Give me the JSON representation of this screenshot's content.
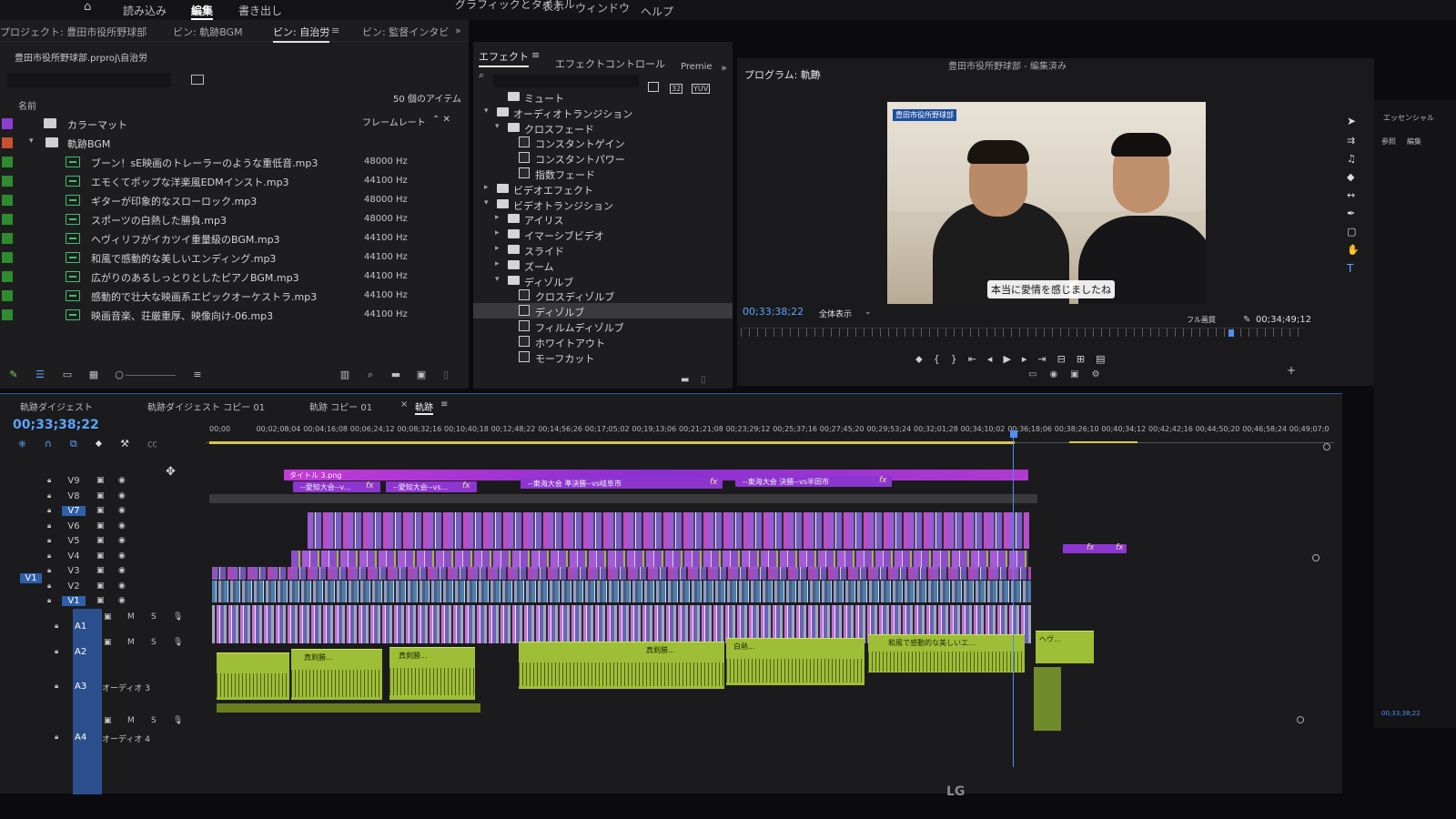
{
  "menubar": {
    "items": [
      "読み込み",
      "編集",
      "書き出し",
      "グラフィックとタイトル",
      "表示",
      "ウィンドウ",
      "ヘルプ"
    ],
    "active": "編集"
  },
  "project": {
    "title": "プロジェクト: 豊田市役所野球部",
    "bins": [
      "ビン: 軌跡BGM",
      "ビン: 自治労",
      "ビン: 監督インタビ"
    ],
    "active_bin": "ビン: 自治労",
    "path": "豊田市役所野球部.prproj\\自治労",
    "item_count": "50 個のアイテム",
    "col_name": "名前",
    "col_framerate": "フレームレート",
    "rows": [
      {
        "name": "カラーマット",
        "hz": "",
        "type": "matte"
      },
      {
        "name": "軌跡BGM",
        "hz": "",
        "type": "folder"
      },
      {
        "name": "ブーン！sE映画のトレーラーのような重低音.mp3",
        "hz": "48000 Hz",
        "type": "audio"
      },
      {
        "name": "エモくてポップな洋楽風EDMインスト.mp3",
        "hz": "44100 Hz",
        "type": "audio"
      },
      {
        "name": "ギターが印象的なスローロック.mp3",
        "hz": "48000 Hz",
        "type": "audio"
      },
      {
        "name": "スポーツの白熱した勝負.mp3",
        "hz": "48000 Hz",
        "type": "audio"
      },
      {
        "name": "ヘヴィリフがイカツイ重量級のBGM.mp3",
        "hz": "44100 Hz",
        "type": "audio"
      },
      {
        "name": "和風で感動的な美しいエンディング.mp3",
        "hz": "44100 Hz",
        "type": "audio"
      },
      {
        "name": "広がりのあるしっとりとしたピアノBGM.mp3",
        "hz": "44100 Hz",
        "type": "audio"
      },
      {
        "name": "感動的で壮大な映画系エピックオーケストラ.mp3",
        "hz": "44100 Hz",
        "type": "audio"
      },
      {
        "name": "映画音楽、荘厳重厚、映像向け-06.mp3",
        "hz": "44100 Hz",
        "type": "audio"
      }
    ]
  },
  "effects": {
    "tabs": [
      "エフェクト",
      "エフェクトコントロール",
      "Premie"
    ],
    "active_tab": "エフェクト",
    "tree": [
      {
        "label": "ミュート",
        "depth": 1,
        "kind": "folder",
        "arrow": ""
      },
      {
        "label": "オーディオトランジション",
        "depth": 0,
        "kind": "folder",
        "arrow": "▾"
      },
      {
        "label": "クロスフェード",
        "depth": 1,
        "kind": "folder",
        "arrow": "▾"
      },
      {
        "label": "コンスタントゲイン",
        "depth": 2,
        "kind": "fx",
        "arrow": ""
      },
      {
        "label": "コンスタントパワー",
        "depth": 2,
        "kind": "fx",
        "arrow": ""
      },
      {
        "label": "指数フェード",
        "depth": 2,
        "kind": "fx",
        "arrow": ""
      },
      {
        "label": "ビデオエフェクト",
        "depth": 0,
        "kind": "folder",
        "arrow": "▸"
      },
      {
        "label": "ビデオトランジション",
        "depth": 0,
        "kind": "folder",
        "arrow": "▾"
      },
      {
        "label": "アイリス",
        "depth": 1,
        "kind": "folder",
        "arrow": "▸"
      },
      {
        "label": "イマーシブビデオ",
        "depth": 1,
        "kind": "folder",
        "arrow": "▸"
      },
      {
        "label": "スライド",
        "depth": 1,
        "kind": "folder",
        "arrow": "▸"
      },
      {
        "label": "ズーム",
        "depth": 1,
        "kind": "folder",
        "arrow": "▸"
      },
      {
        "label": "ディゾルブ",
        "depth": 1,
        "kind": "folder",
        "arrow": "▾"
      },
      {
        "label": "クロスディゾルブ",
        "depth": 2,
        "kind": "fx",
        "arrow": ""
      },
      {
        "label": "ディゾルブ",
        "depth": 2,
        "kind": "fx",
        "arrow": "",
        "selected": true
      },
      {
        "label": "フィルムディゾルブ",
        "depth": 2,
        "kind": "fx",
        "arrow": ""
      },
      {
        "label": "ホワイトアウト",
        "depth": 2,
        "kind": "fx",
        "arrow": ""
      },
      {
        "label": "モーフカット",
        "depth": 2,
        "kind": "fx",
        "arrow": ""
      }
    ]
  },
  "program": {
    "title": "プログラム: 軌跡",
    "header_center": "豊田市役所野球部 - 編集済み",
    "timecode": "00;33;38;22",
    "fit": "全体表示",
    "quality": "フル画質",
    "duration": "00;34;49;12",
    "video_caption_top": "豊田市役所野球部",
    "video_subtitle": "本当に愛情を感じましたね"
  },
  "timeline": {
    "tabs": [
      "軌跡ダイジェスト",
      "軌跡ダイジェスト コピー 01",
      "軌跡 コピー 01",
      "軌跡"
    ],
    "active_tab": "軌跡",
    "timecode": "00;33;38;22",
    "ruler": [
      "00;00",
      "00;02;08;04",
      "00;04;16;08",
      "00;06;24;12",
      "00;08;32;16",
      "00;10;40;18",
      "00;12;48;22",
      "00;14;56;26",
      "00;17;05;02",
      "00;19;13;06",
      "00;21;21;08",
      "00;23;29;12",
      "00;25;37;16",
      "00;27;45;20",
      "00;29;53;24",
      "00;32;01;28",
      "00;34;10;02",
      "00;36;18;06",
      "00;38;26;10",
      "00;40;34;12",
      "00;42;42;16",
      "00;44;50;20",
      "00;46;58;24",
      "00;49;07;0"
    ],
    "video_tracks": [
      "V9",
      "V8",
      "V7",
      "V6",
      "V5",
      "V4",
      "V3",
      "V2",
      "V1"
    ],
    "source_patch": "V1",
    "audio_tracks": [
      {
        "id": "A1",
        "name": ""
      },
      {
        "id": "A2",
        "name": ""
      },
      {
        "id": "A3",
        "name": "オーディオ 3"
      },
      {
        "id": "A4",
        "name": "オーディオ 4"
      }
    ],
    "clip_labels": {
      "title": "タイトル 3.png",
      "c1": "--愛知大会--v...",
      "c2": "--愛知大会--vs...",
      "c3": "--東海大会 準決勝--vs岐阜市",
      "c4": "--東海大会 決勝--vs半田市",
      "a1": "真剣勝...",
      "a2": "真剣勝...",
      "a3": "真剣勝...",
      "a4": "白熱...",
      "a5": "和風で感動的な美しいエ...",
      "a6": "ヘヴ..."
    },
    "track_buttons": {
      "mute": "M",
      "solo": "S"
    }
  },
  "essentials": {
    "title": "エッセンシャル",
    "tabs": [
      "参照",
      "編集"
    ],
    "timecode": "00;33;38;22"
  },
  "monitor_brand": "LG",
  "colors": {
    "accent": "#5ba4ff",
    "audio_clip": "#9fbe37",
    "video_clip": "#9b5bd6",
    "title_clip": "#b13ad0",
    "folder_swatch": "#2e8b2e"
  }
}
